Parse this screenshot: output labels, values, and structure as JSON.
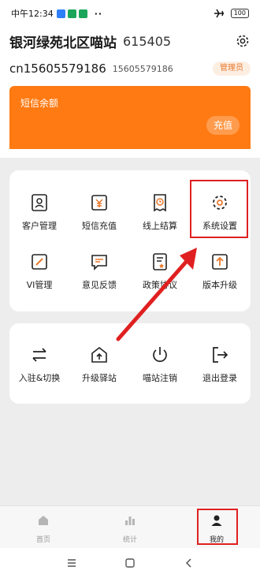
{
  "status_bar": {
    "time": "中午12:34",
    "dots": "··",
    "battery": "100"
  },
  "header": {
    "station_name": "银河绿苑北区喵站",
    "station_code": "615405",
    "account_id": "cn15605579186",
    "account_phone": "15605579186",
    "role_badge": "管理员"
  },
  "sms_card": {
    "title": "短信余额",
    "recharge_label": "充值",
    "color": "#ff7a12"
  },
  "menu_grid": [
    {
      "label": "客户管理",
      "icon": "customer-icon"
    },
    {
      "label": "短信充值",
      "icon": "sms-recharge-icon"
    },
    {
      "label": "线上结算",
      "icon": "settlement-icon"
    },
    {
      "label": "系统设置",
      "icon": "gear-icon"
    },
    {
      "label": "VI管理",
      "icon": "edit-icon"
    },
    {
      "label": "意见反馈",
      "icon": "feedback-icon"
    },
    {
      "label": "政策协议",
      "icon": "policy-icon"
    },
    {
      "label": "版本升级",
      "icon": "upgrade-icon"
    }
  ],
  "account_actions": [
    {
      "label": "入驻&切换",
      "icon": "switch-icon"
    },
    {
      "label": "升级驿站",
      "icon": "upgrade-station-icon"
    },
    {
      "label": "喵站注销",
      "icon": "power-icon"
    },
    {
      "label": "退出登录",
      "icon": "logout-icon"
    }
  ],
  "tabs": [
    {
      "label": "首页",
      "icon": "home-icon",
      "active": false
    },
    {
      "label": "统计",
      "icon": "stats-icon",
      "active": false
    },
    {
      "label": "我的",
      "icon": "profile-icon",
      "active": true
    }
  ],
  "annotation_color": "#e02020"
}
